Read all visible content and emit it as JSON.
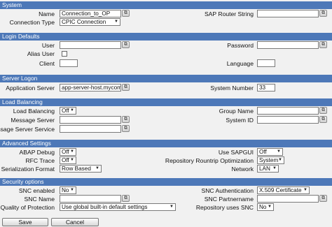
{
  "system": {
    "header": "System",
    "name_label": "Name",
    "name_value": "Connection_to_OP",
    "sap_router_label": "SAP Router String",
    "sap_router_value": "",
    "connection_type_label": "Connection Type",
    "connection_type_value": "CPIC Connection"
  },
  "login_defaults": {
    "header": "Login Defaults",
    "user_label": "User",
    "user_value": "",
    "password_label": "Password",
    "password_value": "",
    "alias_user_label": "Alias User",
    "client_label": "Client",
    "client_value": "",
    "language_label": "Language",
    "language_value": ""
  },
  "server_logon": {
    "header": "Server Logon",
    "app_server_label": "Application Server",
    "app_server_value": "app-server-host.mycompan",
    "system_number_label": "System Number",
    "system_number_value": "33"
  },
  "load_balancing": {
    "header": "Load Balancing",
    "load_balancing_label": "Load Balancing",
    "load_balancing_value": "Off",
    "group_name_label": "Group Name",
    "group_name_value": "",
    "message_server_label": "Message Server",
    "message_server_value": "",
    "system_id_label": "System ID",
    "system_id_value": "",
    "message_server_service_label": "Message Server Service",
    "message_server_service_value": ""
  },
  "advanced": {
    "header": "Advanced Settings",
    "abap_debug_label": "ABAP Debug",
    "abap_debug_value": "Off",
    "use_sapgui_label": "Use SAPGUI",
    "use_sapgui_value": "Off",
    "rfc_trace_label": "RFC Trace",
    "rfc_trace_value": "Off",
    "repo_roundtrip_label": "Repository Rountrip Optimization",
    "repo_roundtrip_value": "System",
    "serialization_label": "Serialization Format",
    "serialization_value": "Row Based",
    "network_label": "Network",
    "network_value": "LAN"
  },
  "security": {
    "header": "Security options",
    "snc_enabled_label": "SNC enabled",
    "snc_enabled_value": "No",
    "snc_auth_label": "SNC Authentication",
    "snc_auth_value": "X.509 Certificate",
    "snc_name_label": "SNC Name",
    "snc_name_value": "",
    "snc_partnername_label": "SNC Partnername",
    "snc_partnername_value": "",
    "qop_label": "Quality of Protection",
    "qop_value": "Use global built-in default settings",
    "repo_uses_snc_label": "Repository uses SNC",
    "repo_uses_snc_value": "No"
  },
  "footer": {
    "save_label": "Save",
    "cancel_label": "Cancel"
  },
  "icons": {
    "value_help": "value-help-icon",
    "dropdown": "chevron-down-icon"
  }
}
